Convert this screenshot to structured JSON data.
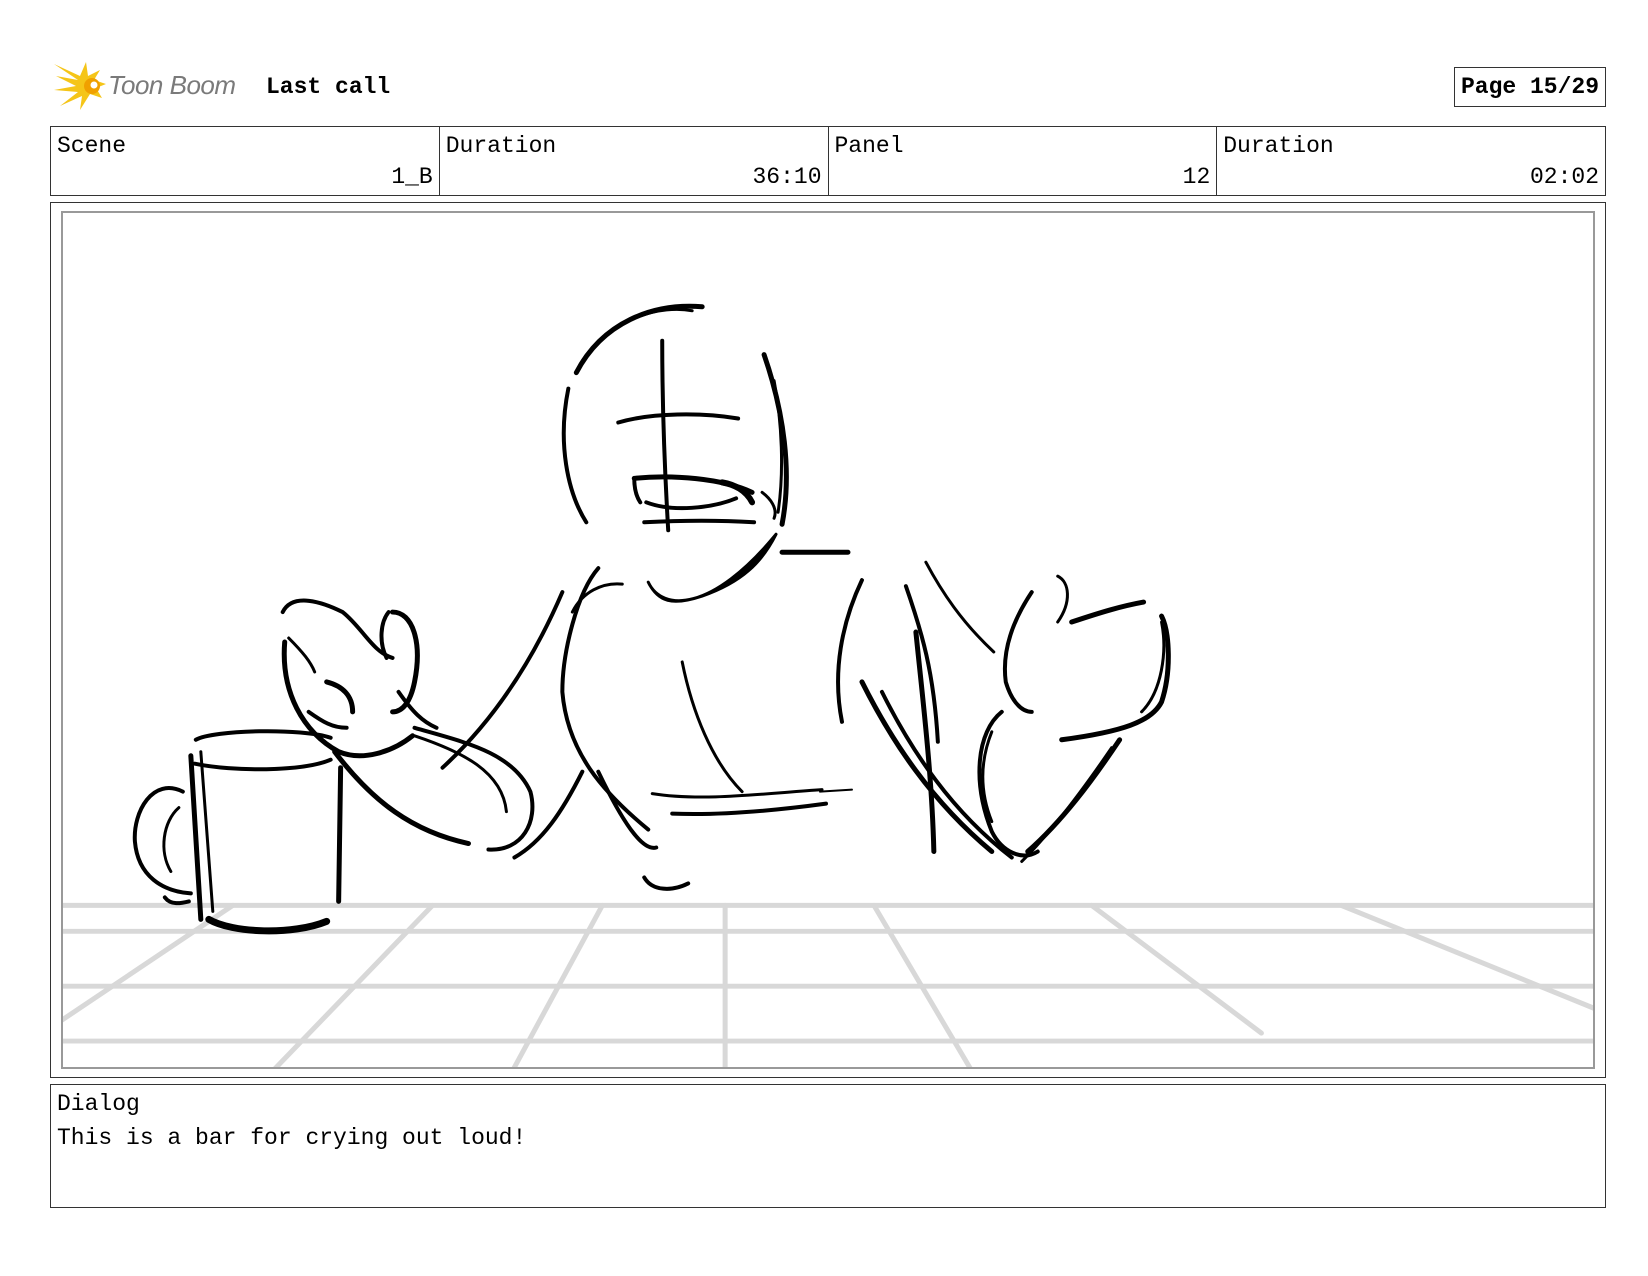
{
  "header": {
    "brand": "Toon Boom",
    "project_title": "Last call",
    "page_label": "Page 15/29"
  },
  "info": {
    "scene_label": "Scene",
    "scene_value": "1_B",
    "scene_duration_label": "Duration",
    "scene_duration_value": "36:10",
    "panel_label": "Panel",
    "panel_value": "12",
    "panel_duration_label": "Duration",
    "panel_duration_value": "02:02"
  },
  "dialog": {
    "label": "Dialog",
    "text": "This is a bar for crying out loud!"
  },
  "colors": {
    "logo_yellow": "#f5c518",
    "logo_orange": "#f0a000",
    "grid_gray": "#d8d8d8"
  }
}
